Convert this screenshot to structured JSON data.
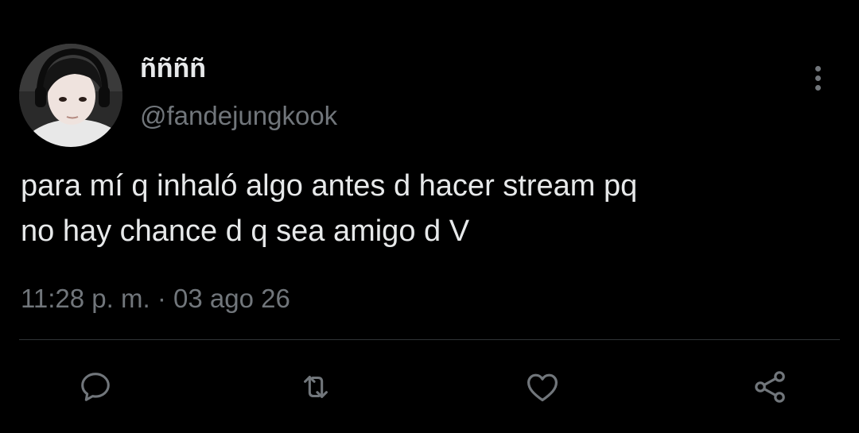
{
  "colors": {
    "background": "#000000",
    "primary_text": "#e7e9ea",
    "secondary_text": "#71767b",
    "divider": "#2f3336"
  },
  "author": {
    "display_name": "ññññ",
    "handle": "@fandejungkook",
    "avatar_icon": "user-avatar-photo"
  },
  "tweet": {
    "text": "para mí q inhaló algo antes d hacer stream pq\nno hay chance d q sea amigo d V",
    "time": "11:28 p. m.",
    "separator": "·",
    "date": "03 ago 26"
  },
  "actions": [
    {
      "icon": "reply-icon"
    },
    {
      "icon": "retweet-icon"
    },
    {
      "icon": "like-icon"
    },
    {
      "icon": "share-icon"
    }
  ],
  "menu": {
    "icon": "more-vertical-icon"
  }
}
